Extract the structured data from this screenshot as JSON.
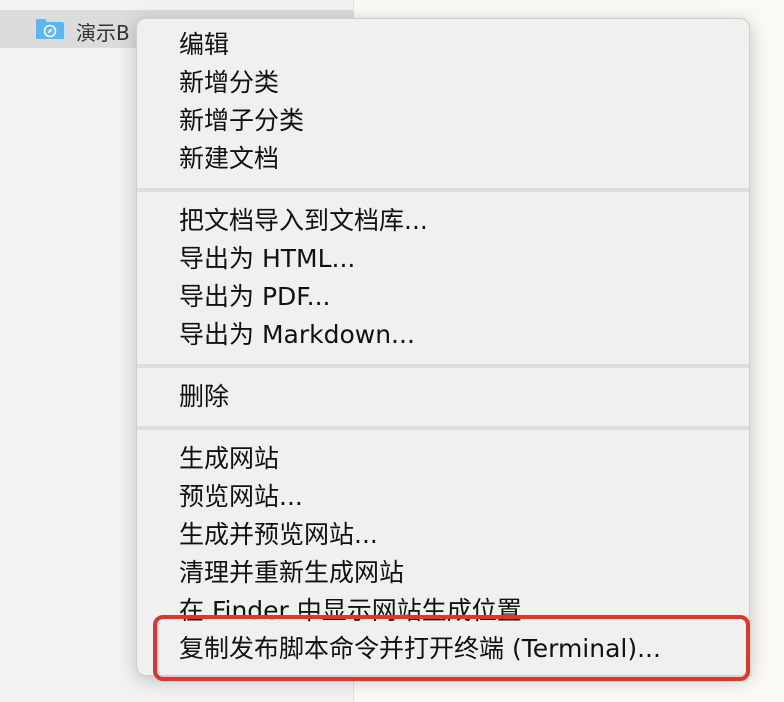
{
  "sidebar": {
    "selected_item": {
      "label": "演示B",
      "icon": "folder-compass-icon",
      "icon_color": "#5bb6f2"
    }
  },
  "context_menu": {
    "groups": [
      [
        "编辑",
        "新增分类",
        "新增子分类",
        "新建文档"
      ],
      [
        "把文档导入到文档库...",
        "导出为 HTML...",
        "导出为 PDF...",
        "导出为 Markdown..."
      ],
      [
        "删除"
      ],
      [
        "生成网站",
        "预览网站...",
        "生成并预览网站...",
        "清理并重新生成网站",
        "在 Finder 中显示网站生成位置...",
        "复制发布脚本命令并打开终端 (Terminal)..."
      ]
    ]
  },
  "annotation": {
    "highlight_color": "#e5332a"
  }
}
